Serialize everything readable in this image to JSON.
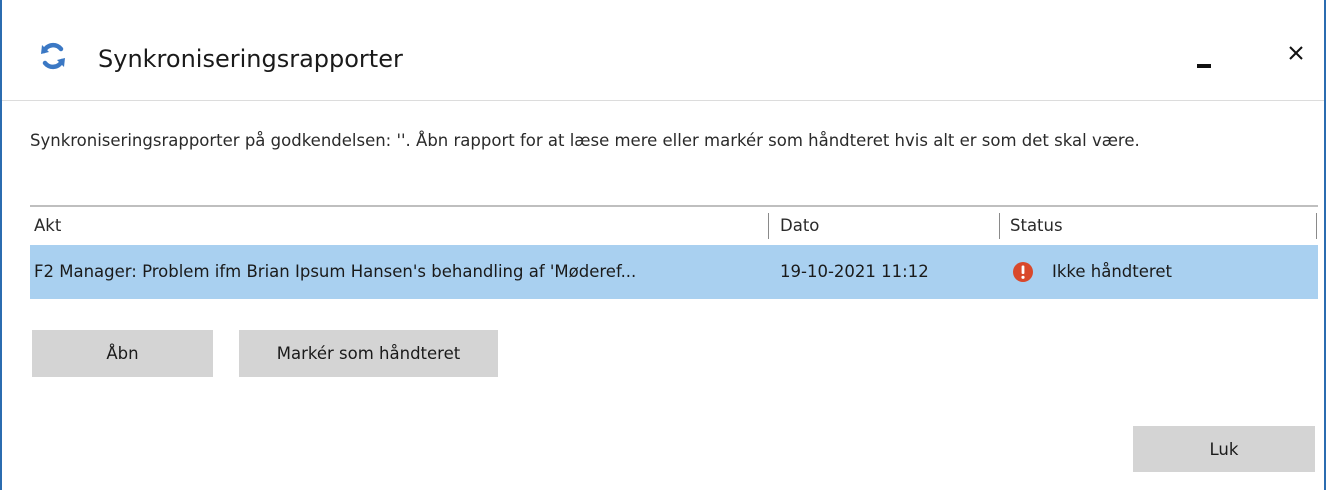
{
  "window": {
    "title": "Synkroniseringsrapporter",
    "app_icon": "sync-icon",
    "controls": {
      "minimize_icon": "minimize-icon",
      "close_icon": "close-icon"
    }
  },
  "description": "Synkroniseringsrapporter på godkendelsen: ''. Åbn rapport for at læse mere eller markér som håndteret hvis alt er som det skal være.",
  "table": {
    "columns": [
      "Akt",
      "Dato",
      "Status"
    ],
    "rows": [
      {
        "akt": "F2 Manager: Problem ifm Brian Ipsum Hansen's behandling af 'Møderef...",
        "dato": "19-10-2021 11:12",
        "status": "Ikke håndteret",
        "status_icon": "error-icon",
        "selected": true
      }
    ]
  },
  "buttons": {
    "open": "Åbn",
    "mark_handled": "Markér som håndteret",
    "close": "Luk"
  },
  "colors": {
    "selection": "#a9d0f0",
    "button": "#d4d4d4",
    "accent": "#2b6cb0",
    "error": "#d9482b"
  }
}
